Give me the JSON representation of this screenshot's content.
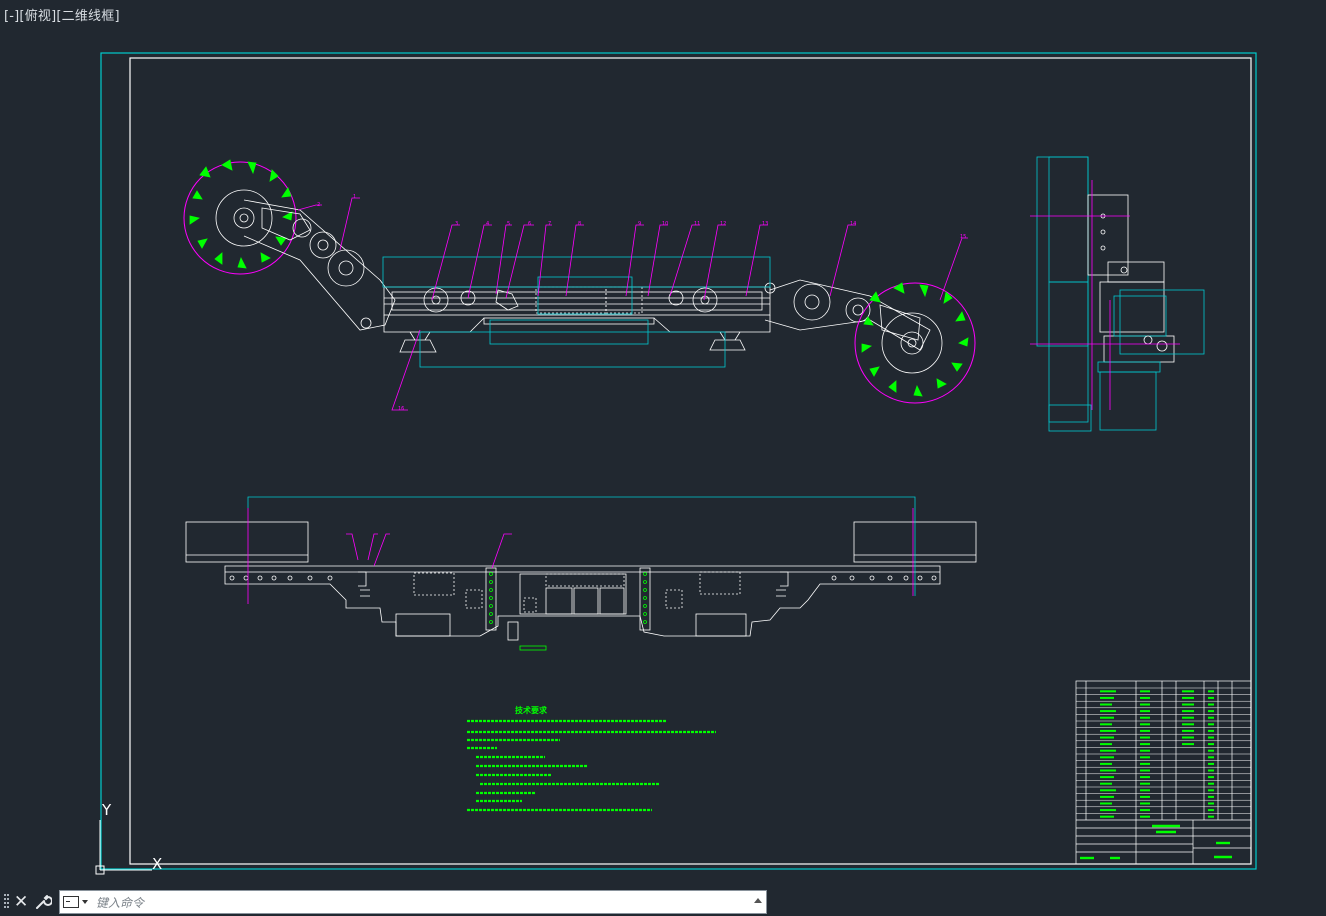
{
  "viewport": {
    "label": "[-][俯视][二维线框]"
  },
  "drawing": {
    "tech_title": "技术要求",
    "colors": {
      "background": "#212830",
      "frame": "#00cccc",
      "geometry": "#ffffff",
      "annotation": "#ff00ff",
      "text": "#00ff00",
      "cyan": "#00c8d0"
    }
  },
  "ucs": {
    "x_label": "X",
    "y_label": "Y"
  },
  "command": {
    "placeholder": "键入命令",
    "close_icon": "close-icon",
    "settings_icon": "wrench-icon",
    "prompt_icon": "command-prompt-icon"
  }
}
